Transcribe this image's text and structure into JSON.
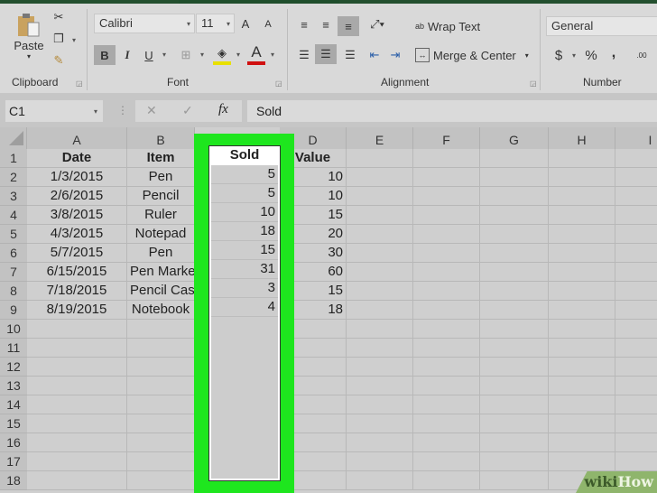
{
  "ribbon": {
    "clipboard": {
      "paste_label": "Paste",
      "group_label": "Clipboard"
    },
    "font": {
      "font_name": "Calibri",
      "font_size": "11",
      "bold": "B",
      "italic": "I",
      "underline": "U",
      "group_label": "Font",
      "increase": "A",
      "decrease": "A"
    },
    "alignment": {
      "wrap_text": "Wrap Text",
      "merge_center": "Merge & Center",
      "group_label": "Alignment",
      "wrap_icon": "ab"
    },
    "number": {
      "format": "General",
      "currency": "$",
      "percent": "%",
      "comma": ",",
      "group_label": "Number"
    }
  },
  "formula_bar": {
    "name_box": "C1",
    "fx": "fx",
    "cancel": "✕",
    "enter": "✓",
    "content": "Sold"
  },
  "columns": [
    "A",
    "B",
    "C",
    "D",
    "E",
    "F",
    "G",
    "H",
    "I"
  ],
  "rows": [
    "1",
    "2",
    "3",
    "4",
    "5",
    "6",
    "7",
    "8",
    "9",
    "10",
    "11",
    "12",
    "13",
    "14",
    "15",
    "16",
    "17",
    "18"
  ],
  "table": {
    "headers": [
      "Date",
      "Item",
      "Sold",
      "Value"
    ],
    "data": [
      [
        "1/3/2015",
        "Pen",
        "5",
        "10"
      ],
      [
        "2/6/2015",
        "Pencil",
        "5",
        "10"
      ],
      [
        "3/8/2015",
        "Ruler",
        "10",
        "15"
      ],
      [
        "4/3/2015",
        "Notepad",
        "18",
        "20"
      ],
      [
        "5/7/2015",
        "Pen",
        "15",
        "30"
      ],
      [
        "6/15/2015",
        "Pen Marker",
        "31",
        "60"
      ],
      [
        "7/18/2015",
        "Pencil Case",
        "3",
        "15"
      ],
      [
        "8/19/2015",
        "Notebook",
        "4",
        "18"
      ]
    ]
  },
  "highlight": {
    "column": "C",
    "color": "#1ee61e"
  },
  "watermark": {
    "wiki": "wiki",
    "how": "How"
  }
}
